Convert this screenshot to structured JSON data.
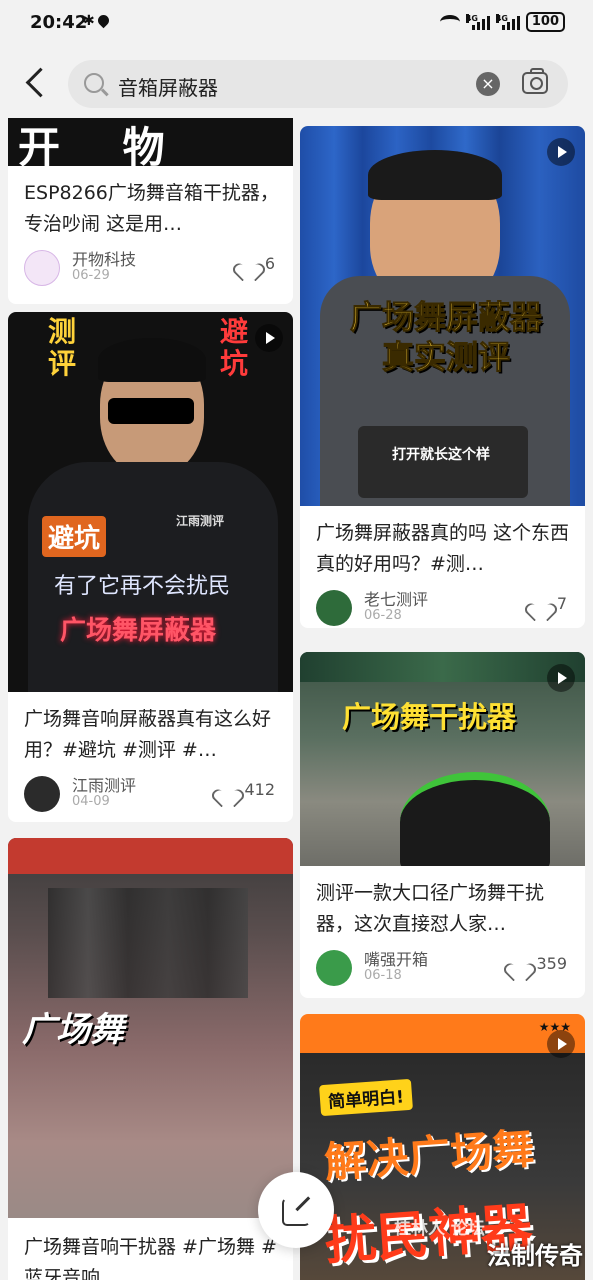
{
  "status_bar": {
    "time": "20:42",
    "battery": "100",
    "network": "4G"
  },
  "search": {
    "query": "音箱屏蔽器"
  },
  "cards": [
    {
      "title": "ESP8266广场舞音箱干扰器，专治吵闹 这是用…",
      "author": "开物科技",
      "date": "06-29",
      "likes": "6",
      "thumb_text": "开 物 科 技"
    },
    {
      "title": "广场舞屏蔽器真的吗 这个东西真的好用吗？#测…",
      "author": "老七测评",
      "date": "06-28",
      "likes": "7",
      "thumb_text": [
        "广场舞屏蔽器",
        "真实测评"
      ],
      "caption": "打开就长这个样"
    },
    {
      "title": "广场舞音响屏蔽器真有这么好用？#避坑 #测评 #…",
      "author": "江雨测评",
      "date": "04-09",
      "likes": "412",
      "thumb_text": {
        "left": "测评",
        "right": "避坑",
        "tag": "避坑",
        "subtitle": "有了它再不会扰民",
        "headline": "广场舞屏蔽器",
        "vest": "江雨测评"
      }
    },
    {
      "title": "测评一款大口径广场舞干扰器，这次直接怼人家…",
      "author": "嘴强开箱",
      "date": "06-18",
      "likes": "359",
      "thumb_text": "广场舞干扰器"
    },
    {
      "title": "广场舞音响干扰器 #广场舞 #蓝牙音响",
      "thumb_text": "广场舞"
    },
    {
      "thumb_text": {
        "badge": "简单明白!",
        "line1": "解决广场舞",
        "line2": "扰民神器"
      }
    }
  ],
  "watermark": {
    "text": "法制传奇",
    "forum": "桂林人 论坛"
  }
}
